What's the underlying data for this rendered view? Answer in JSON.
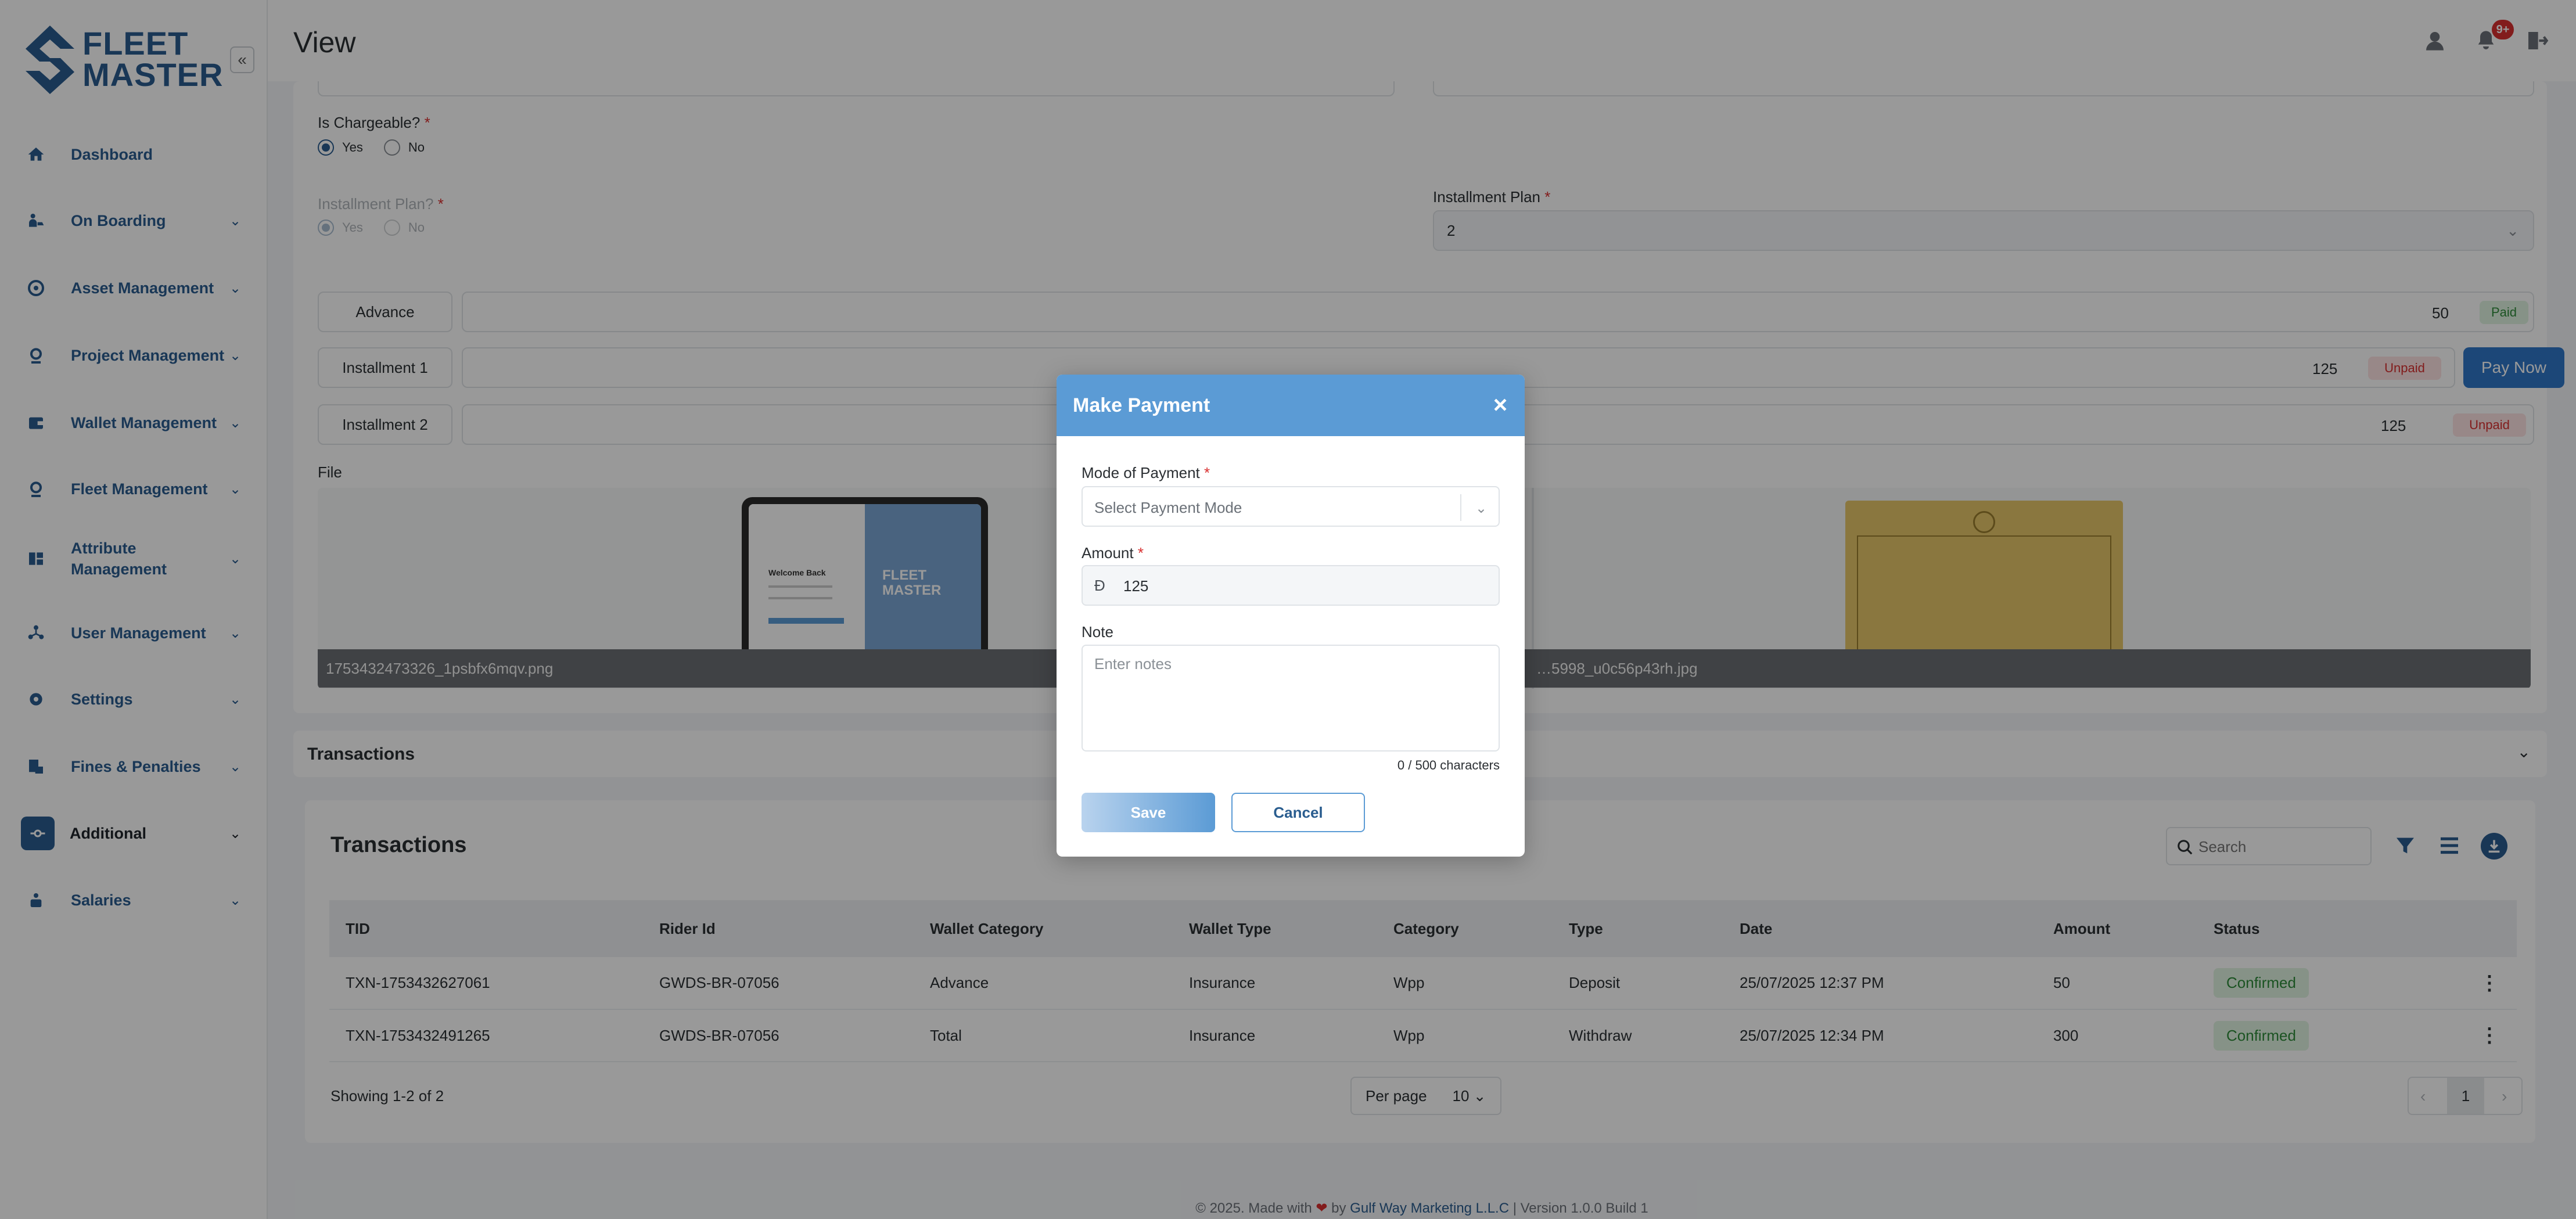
{
  "brand": {
    "line1": "FLEET",
    "line2": "MASTER"
  },
  "header": {
    "title": "View",
    "notifications_badge": "9+"
  },
  "sidebar": {
    "items": [
      {
        "label": "Dashboard",
        "icon": "home-icon"
      },
      {
        "label": "On Boarding",
        "icon": "rider-icon"
      },
      {
        "label": "Asset Management",
        "icon": "asset-icon"
      },
      {
        "label": "Project Management",
        "icon": "project-icon"
      },
      {
        "label": "Wallet Management",
        "icon": "wallet-icon"
      },
      {
        "label": "Fleet Management",
        "icon": "fleet-icon"
      },
      {
        "label": "Attribute",
        "label2": "Management",
        "icon": "attribute-icon"
      },
      {
        "label": "User Management",
        "icon": "users-icon"
      },
      {
        "label": "Settings",
        "icon": "gear-icon"
      },
      {
        "label": "Fines & Penalties",
        "icon": "fines-icon"
      },
      {
        "label": "Additional",
        "icon": "additional-icon"
      },
      {
        "label": "Salaries",
        "icon": "salaries-icon"
      }
    ]
  },
  "form": {
    "chargeable": {
      "label": "Is Chargeable?",
      "yes": "Yes",
      "no": "No"
    },
    "installment_q": {
      "label": "Installment Plan?",
      "yes": "Yes",
      "no": "No"
    },
    "installment_plan": {
      "label": "Installment Plan",
      "value": "2"
    },
    "payments": [
      {
        "label": "Advance",
        "amount": "50",
        "status": "Paid"
      },
      {
        "label": "Installment 1",
        "amount": "125",
        "status": "Unpaid",
        "action": "Pay Now"
      },
      {
        "label": "Installment 2",
        "amount": "125",
        "status": "Unpaid"
      }
    ],
    "file": {
      "label": "File",
      "files": [
        "1753432473326_1psbfx6mqv.png",
        "…5998_u0c56p43rh.jpg"
      ],
      "thumb_logo": "FLEET MASTER",
      "thumb_welcome": "Welcome Back"
    }
  },
  "transactions": {
    "section_title": "Transactions",
    "card_title": "Transactions",
    "search_placeholder": "Search",
    "columns": [
      "TID",
      "Rider Id",
      "Wallet Category",
      "Wallet Type",
      "Category",
      "Type",
      "Date",
      "Amount",
      "Status"
    ],
    "rows": [
      [
        "TXN-1753432627061",
        "GWDS-BR-07056",
        "Advance",
        "Insurance",
        "Wpp",
        "Deposit",
        "25/07/2025 12:37 PM",
        "50",
        "Confirmed"
      ],
      [
        "TXN-1753432491265",
        "GWDS-BR-07056",
        "Total",
        "Insurance",
        "Wpp",
        "Withdraw",
        "25/07/2025 12:34 PM",
        "300",
        "Confirmed"
      ]
    ],
    "showing": "Showing 1-2 of 2",
    "per_page_label": "Per page",
    "per_page_value": "10",
    "page": "1"
  },
  "modal": {
    "title": "Make Payment",
    "mode_label": "Mode of Payment",
    "mode_placeholder": "Select Payment Mode",
    "amount_label": "Amount",
    "currency_symbol": "Đ",
    "amount_value": "125",
    "note_label": "Note",
    "note_placeholder": "Enter notes",
    "counter": "0 / 500 characters",
    "save": "Save",
    "cancel": "Cancel"
  },
  "footer": {
    "prefix": "© 2025. Made with",
    "by": "by",
    "company": "Gulf Way Marketing L.L.C",
    "version": "| Version 1.0.0 Build 1"
  },
  "colors": {
    "primary": "#2a5d8f",
    "modal_header": "#5b9bd5",
    "paid": "#2e8b3a",
    "unpaid": "#d93030"
  }
}
